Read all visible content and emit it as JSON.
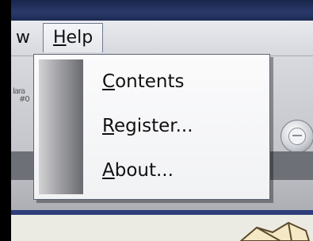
{
  "menu_bar": {
    "partial_item": "w",
    "help": {
      "accel": "H",
      "rest": "elp"
    }
  },
  "toolbar": {
    "scrap_text_1": "lara",
    "scrap_text_2": "#0"
  },
  "help_menu": {
    "items": [
      {
        "accel": "C",
        "rest": "ontents",
        "name": "contents"
      },
      {
        "accel": "R",
        "rest": "egister...",
        "name": "register"
      },
      {
        "accel": "A",
        "rest": "bout...",
        "name": "about"
      }
    ]
  },
  "colors": {
    "title_bar": "#2a3a6b",
    "menu_bg": "#f1f2f4",
    "menu_border": "#5d6478"
  },
  "icons": {
    "zoom": "zoom-dial-icon",
    "document": "document-graphic-icon"
  }
}
